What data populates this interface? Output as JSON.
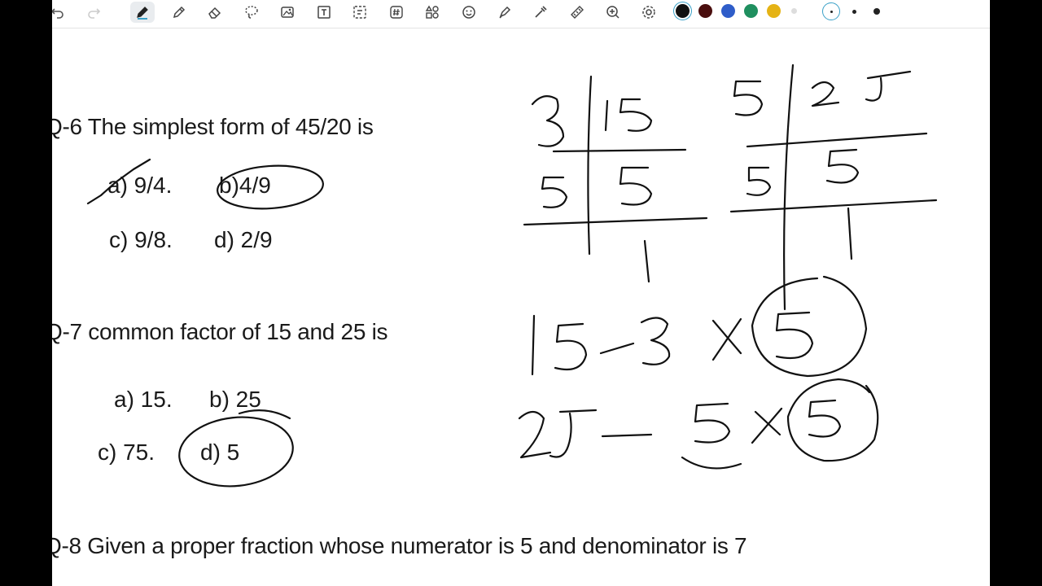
{
  "toolbar": {
    "tools": [
      "undo-icon",
      "redo-icon",
      "pen-icon",
      "pencil-icon",
      "eraser-icon",
      "lasso-icon",
      "image-icon",
      "text-icon",
      "selection-icon",
      "hashtag-icon",
      "shapes-icon",
      "sticker-icon",
      "highlighter-icon",
      "laser-pointer-icon",
      "ruler-icon",
      "zoom-icon",
      "settings-icon"
    ],
    "active_tool": "pen-icon",
    "colors": [
      "#111111",
      "#4a0e0e",
      "#2f5dc9",
      "#1f8f5f",
      "#e5b315",
      "#dddddd"
    ],
    "selected_color": "#111111"
  },
  "q6": {
    "text": "Q-6 The simplest form of 45/20 is",
    "a": "a) 9/4.",
    "b": "b)4/9",
    "c": "c) 9/8.",
    "d": "d) 2/9"
  },
  "q7": {
    "text": "Q-7 common factor of 15 and 25 is",
    "a": "a) 15.",
    "b": "b) 25",
    "c": "c) 75.",
    "d": "d) 5"
  },
  "q8": {
    "text": "Q-8 Given a proper fraction whose numerator is 5 and denominator is 7"
  }
}
